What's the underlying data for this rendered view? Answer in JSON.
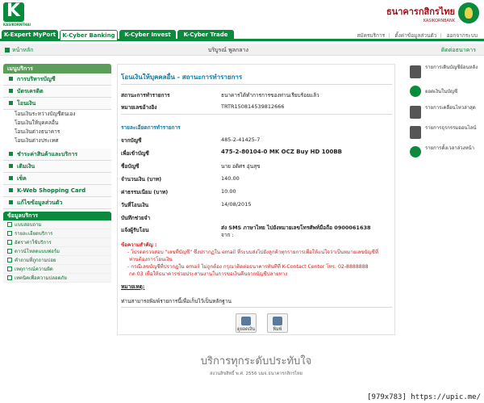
{
  "brand": {
    "logo_text": "KASIKORNTHAI",
    "bank_name_th": "ธนาคารกสิกรไทย",
    "bank_name_en": "KASIKORNBANK",
    "colors": {
      "primary_green": "#0a8a3c",
      "title_blue": "#0a7aaa",
      "alert_red": "#d0201f",
      "bank_red": "#a0121e"
    }
  },
  "nav": {
    "tabs": [
      "K-Expert MyPort",
      "K-Cyber Banking",
      "K-Cyber Invest",
      "K-Cyber Trade"
    ],
    "active_tab": "K-Cyber Banking",
    "links": [
      "สมัครบริการ",
      "ตั้งค่าข้อมูลส่วนตัว",
      "ออกจากระบบ"
    ]
  },
  "subbar": {
    "home": "หน้าหลัก",
    "greeting": "บริบูรณ์ พูลกลาง",
    "contact": "ติดต่อธนาคาร"
  },
  "sidebar": {
    "menu_title": "เมนูบริการ",
    "items": [
      {
        "label": "การบริหารบัญชี"
      },
      {
        "label": "บัตรเครดิต"
      },
      {
        "label": "โอนเงิน"
      }
    ],
    "transfer_sub": [
      "โอนเงินระหว่างบัญชีตนเอง",
      "โอนเงินให้บุคคลอื่น",
      "โอนเงินต่างธนาคาร",
      "โอนเงินต่างประเทศ"
    ],
    "more_items": [
      {
        "label": "ชำระค่าสินค้าและบริการ"
      },
      {
        "label": "เติมเงิน"
      },
      {
        "label": "เช็ค"
      },
      {
        "label": "K-Web Shopping Card"
      },
      {
        "label": "แก้ไขข้อมูลส่วนตัว"
      }
    ],
    "info_title": "ข้อมูลบริการ",
    "info_items": [
      "แบบสอบถาม",
      "รายละเอียดบริการ",
      "อัตราค่าใช้บริการ",
      "ดาวน์โหลดแบบฟอร์ม",
      "คำถามที่ถูกถามบ่อย",
      "เหตุการณ์ความผิด",
      "เทคนิคเพื่อความปลอดภัย"
    ]
  },
  "main": {
    "title": "โอนเงินให้บุคคลอื่น - สถานะการทำรายการ",
    "status_label": "สถานะการทำรายการ",
    "status_value": "ธนาคารได้ทำการการของท่านเรียบร้อยแล้ว",
    "ref_label": "หมายเลขอ้างอิง",
    "ref_value": "TRTR150814539812666",
    "section_title": "รายละเอียดการทำรายการ",
    "rows": [
      {
        "label": "จากบัญชี",
        "value": "485-2-41425-7",
        "bold": false
      },
      {
        "label": "เพื่อเข้าบัญชี",
        "value": "475-2-80104-0 MK OCZ Buy HD 100BB",
        "bold": true
      },
      {
        "label": "ชื่อบัญชี",
        "value": "นาย อดิศร อุ่นสุข",
        "bold": false
      },
      {
        "label": "จำนวนเงิน (บาท)",
        "value": "140.00",
        "bold": false
      },
      {
        "label": "ค่าธรรมเนียม (บาท)",
        "value": "10.00",
        "bold": false
      },
      {
        "label": "วันที่โอนเงิน",
        "value": "14/08/2015",
        "bold": false
      },
      {
        "label": "บันทึกช่วยจำ",
        "value": "",
        "bold": false
      }
    ],
    "notify_label": "แจ้งผู้รับโอน",
    "notify_value_1": "ส่ง SMS ภาษาไทย ไปยังหมายเลขโทรศัพท์มือถือ 0900061638",
    "notify_value_2": "จาก :",
    "note_heading": "ข้อความสำคัญ :",
    "note_1a": "- โปรดตรวจสอบ \"เลขที่บัญชี\" ซึ่งปรากฏใน email ที่ระบบส่งไปยังลูกค้าทุกรายการเพื่อให้แน่ใจว่าเป็นหมายเลขบัญชีที่",
    "note_1b": "ท่านต้องการโอนเงิน",
    "note_2a": "- กรณีเลขบัญชีที่ปรากฏใน email ไม่ถูกต้อง กรุณาติดต่อธนาคารทันทีที่ K-Contact Center โทร. 02-8888888",
    "note_2b": "กด 03 เพื่อให้ธนาคารช่วยประสานงานในการขอเงินคืนจากบัญชีปลายทาง",
    "remark_heading": "หมายเหตุ:",
    "remark_text": "ท่านสามารถพิมพ์รายการนี้เพื่อเก็บไว้เป็นหลักฐาน",
    "btn_view": "ดูยอดเงิน",
    "btn_print": "พิมพ์"
  },
  "right_panel": [
    {
      "label": "รายการเดินบัญชีย้อนหลัง",
      "icon": "document-icon"
    },
    {
      "label": "ยอดเงินในบัญชี",
      "icon": "coin-icon"
    },
    {
      "label": "รายการเคลื่อนไหวล่าสุด",
      "icon": "document-icon"
    },
    {
      "label": "รายการธุรกรรมออนไลน์",
      "icon": "document-icon"
    },
    {
      "label": "รายการตั้งเวลาล่วงหน้า",
      "icon": "clock-icon"
    }
  ],
  "footer": {
    "slogan": "บริการทุกระดับประทับใจ",
    "copyright": "สงวนลิขสิทธิ์ พ.ศ. 2556 บมจ.ธนาคารกสิกรไทย"
  },
  "watermark": "[979x783] https://upic.me/"
}
